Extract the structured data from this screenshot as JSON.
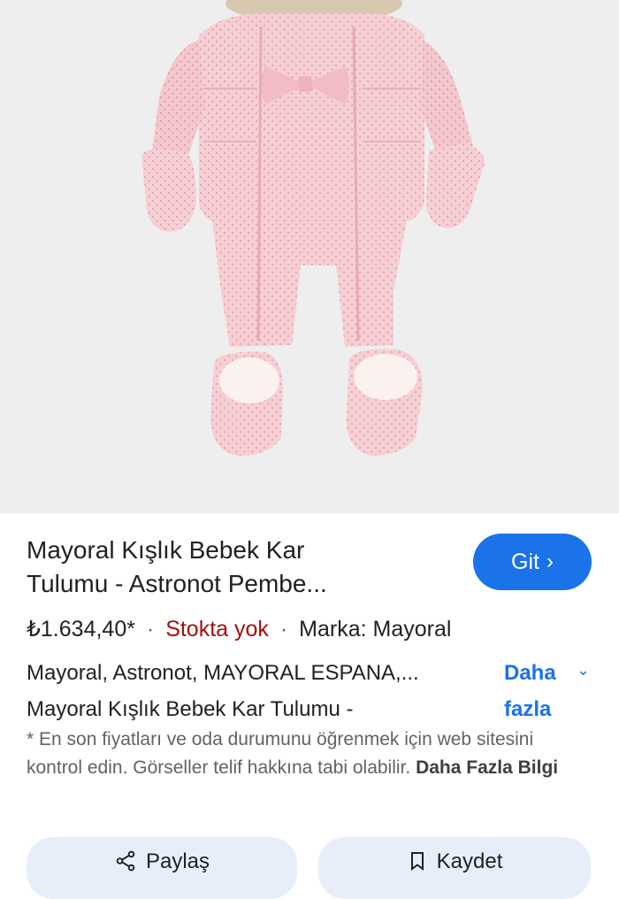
{
  "product": {
    "image_alt": "Pink baby snowsuit",
    "title_line1": "Mayoral Kışlık Bebek Kar",
    "title_line2": "Tulumu - Astronot Pembe...",
    "price": "₺1.634,40*",
    "separator": "·",
    "stock": "Stokta yok",
    "brand": "Marka: Mayoral",
    "desc_line1": "Mayoral, Astronot, MAYORAL ESPANA,...",
    "desc_line2": "Mayoral Kışlık Bebek Kar Tulumu -"
  },
  "actions": {
    "go_label": "Git",
    "more_line1": "Daha",
    "more_line2": "fazla",
    "share_label": "Paylaş",
    "save_label": "Kaydet"
  },
  "note": {
    "text": "* En son fiyatları ve oda durumunu öğrenmek için web sitesini kontrol edin. Görseller telif hakkına tabi olabilir.",
    "link": "Daha Fazla Bilgi"
  },
  "colors": {
    "accent": "#1a73e8",
    "stock_out": "#a50e0e",
    "suit_pink": "#f6cfd4"
  }
}
